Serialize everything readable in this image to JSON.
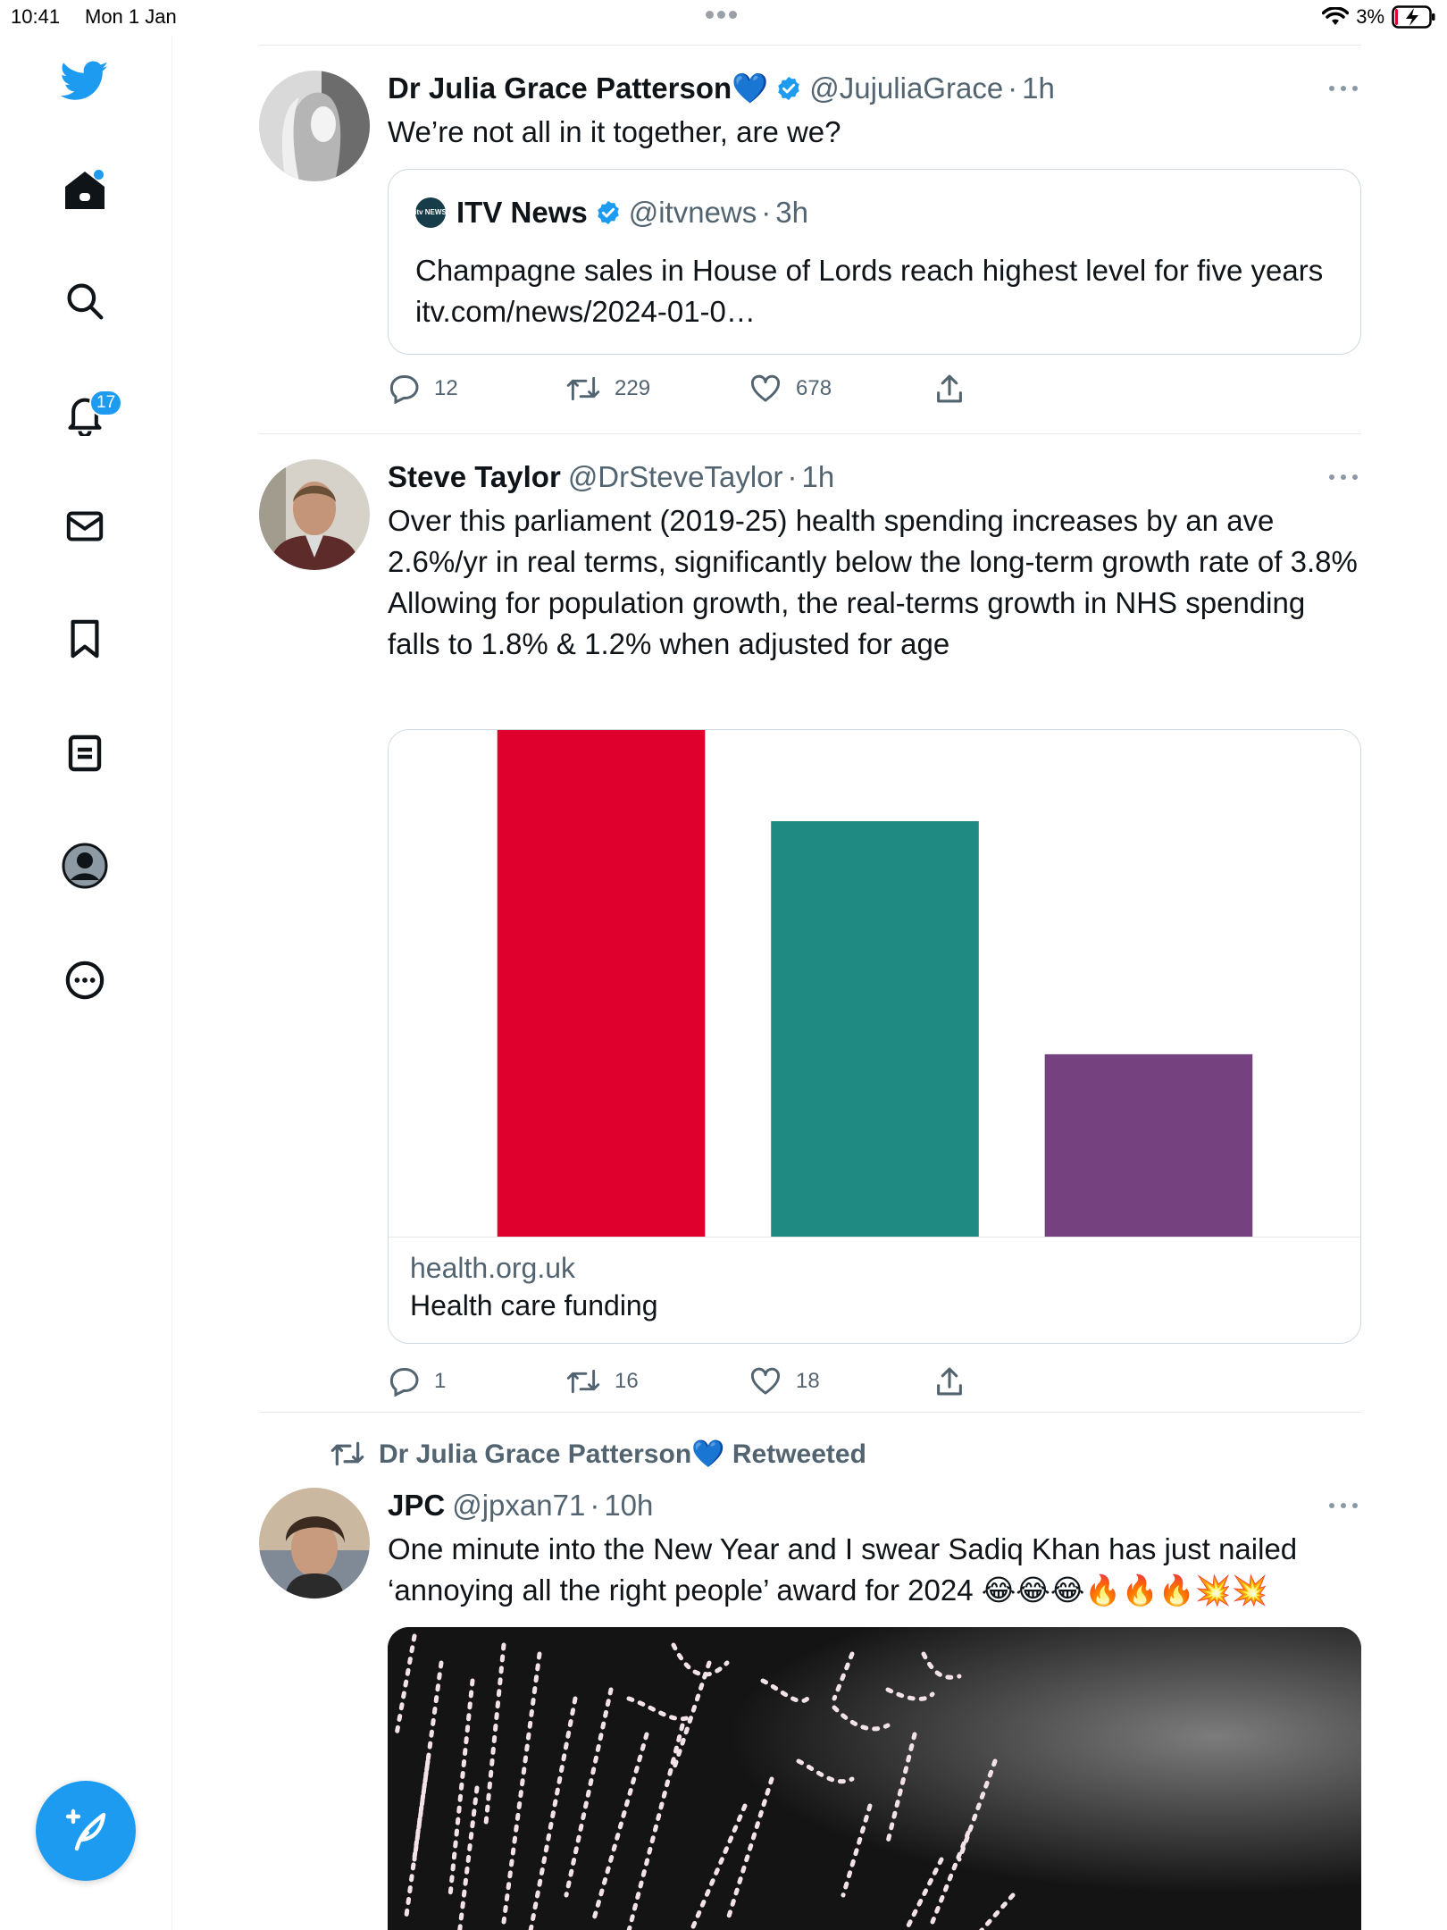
{
  "status_bar": {
    "time": "10:41",
    "date": "Mon 1 Jan",
    "battery": "3%"
  },
  "sidebar": {
    "items": [
      {
        "name": "twitter-logo"
      },
      {
        "name": "home"
      },
      {
        "name": "explore"
      },
      {
        "name": "notifications",
        "badge": "17"
      },
      {
        "name": "messages"
      },
      {
        "name": "bookmarks"
      },
      {
        "name": "lists"
      },
      {
        "name": "profile"
      },
      {
        "name": "more"
      }
    ]
  },
  "tweets": [
    {
      "name": "Dr Julia Grace Patterson",
      "name_emoji": "💙",
      "handle": "@JujuliaGrace",
      "time": "1h",
      "text": "We’re not all in it together, are we?",
      "quote": {
        "logo_text": "itv NEWS",
        "name": "ITV News",
        "handle": "@itvnews",
        "time": "3h",
        "text": "Champagne sales in House of Lords reach highest level for five years itv.com/news/2024-01-0…"
      },
      "stats": {
        "replies": "12",
        "retweets": "229",
        "likes": "678"
      }
    },
    {
      "name": "Steve Taylor",
      "handle": "@DrSteveTaylor",
      "time": "1h",
      "text": "Over this parliament (2019-25) health spending increases by an ave 2.6%/yr in real terms, significantly below the long-term growth rate of 3.8%\nAllowing for population growth, the real-terms growth in NHS spending falls to 1.8% & 1.2% when adjusted for age",
      "card": {
        "domain": "health.org.uk",
        "title": "Health care funding"
      },
      "stats": {
        "replies": "1",
        "retweets": "16",
        "likes": "18"
      }
    },
    {
      "retweeted_by": "Dr Julia Grace Patterson",
      "retweeted_emoji": "💙",
      "retweeted_label": "Retweeted",
      "name": "JPC",
      "handle": "@jpxan71",
      "time": "10h",
      "text": "One minute into the New Year and I swear Sadiq Khan has just nailed ‘annoying all the right people’ award for 2024 😂😂😂🔥🔥🔥💥💥"
    }
  ],
  "chart_data": {
    "type": "bar",
    "categories": [
      "",
      "",
      ""
    ],
    "values": [
      100,
      82,
      36
    ],
    "colors": [
      "#e0002e",
      "#1e8a82",
      "#76417f"
    ],
    "ylim": [
      0,
      100
    ],
    "title": "",
    "xlabel": "",
    "ylabel": "",
    "grid": false
  },
  "colors": {
    "accent": "#1d9bf0",
    "text": "#0f1419",
    "secondary": "#536471",
    "border": "#cfd9de"
  }
}
